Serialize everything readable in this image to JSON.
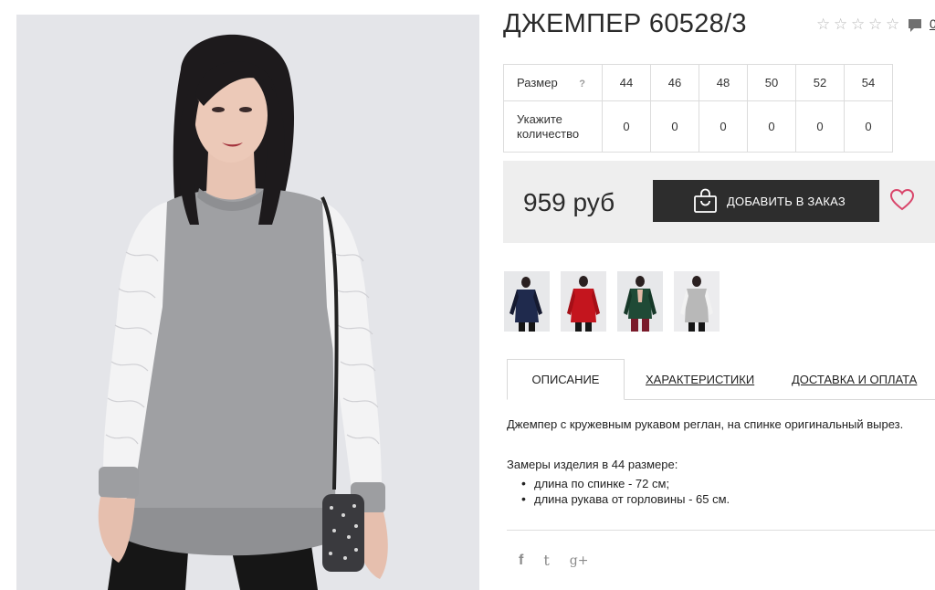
{
  "product": {
    "title": "ДЖЕМПЕР 60528/3",
    "rating_stars": 5,
    "rating_filled": 0,
    "comment_count": "0"
  },
  "size_table": {
    "size_label": "Размер",
    "help_glyph": "?",
    "qty_label": "Укажите количество",
    "sizes": [
      "44",
      "46",
      "48",
      "50",
      "52",
      "54"
    ],
    "quantities": [
      "0",
      "0",
      "0",
      "0",
      "0",
      "0"
    ]
  },
  "buy": {
    "price": "959 руб",
    "add_label": "ДОБАВИТЬ В ЗАКАЗ",
    "button_color": "#2d2d2d",
    "heart_color": "#d9466b"
  },
  "color_variants": [
    {
      "name": "navy",
      "color": "#1f2a4d"
    },
    {
      "name": "red",
      "color": "#c4151e"
    },
    {
      "name": "green",
      "color": "#1f4a36"
    },
    {
      "name": "gray",
      "color": "#b8b8b8"
    }
  ],
  "tabs": [
    {
      "label": "ОПИСАНИЕ",
      "active": true
    },
    {
      "label": "ХАРАКТЕРИСТИКИ",
      "active": false
    },
    {
      "label": "ДОСТАВКА И ОПЛАТА",
      "active": false
    }
  ],
  "description": {
    "text": "Джемпер с кружевным рукавом реглан, на спинке оригинальный вырез.",
    "measures_title": "Замеры изделия в 44 размере:",
    "measures": [
      "длина по спинке - 72 см;",
      "длина рукава от горловины - 65 см."
    ]
  },
  "social": {
    "facebook": "f",
    "twitter": "t",
    "google_plus": "g+"
  }
}
